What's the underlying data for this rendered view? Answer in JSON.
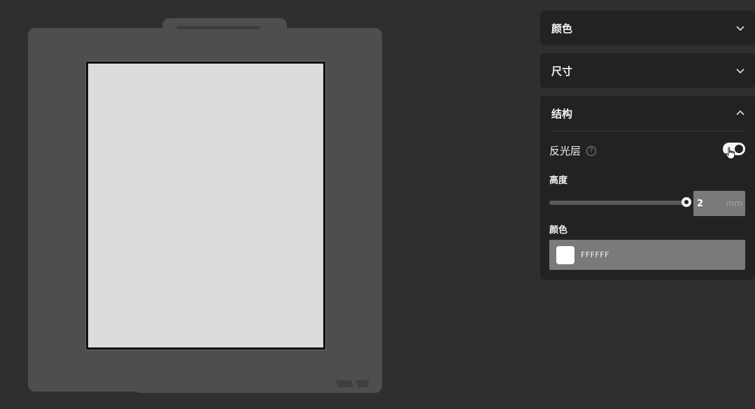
{
  "panel": {
    "sections": {
      "color": {
        "title": "颜色",
        "expanded": false
      },
      "size": {
        "title": "尺寸",
        "expanded": false
      },
      "structure": {
        "title": "结构",
        "expanded": true,
        "reflect_layer": {
          "label": "反光层",
          "help_icon": "question-circle-icon",
          "enabled": true
        },
        "height": {
          "label": "高度",
          "value": "2",
          "unit": "mm",
          "slider_fraction": 1.0
        },
        "color": {
          "label": "颜色",
          "hex": "FFFFFF",
          "swatch": "#ffffff"
        }
      }
    }
  },
  "colors": {
    "background": "#2f2f31",
    "frame": "#4e4e51",
    "paper": "#dcdcdc",
    "panel": "#222224",
    "input": "#7a7a7d"
  }
}
